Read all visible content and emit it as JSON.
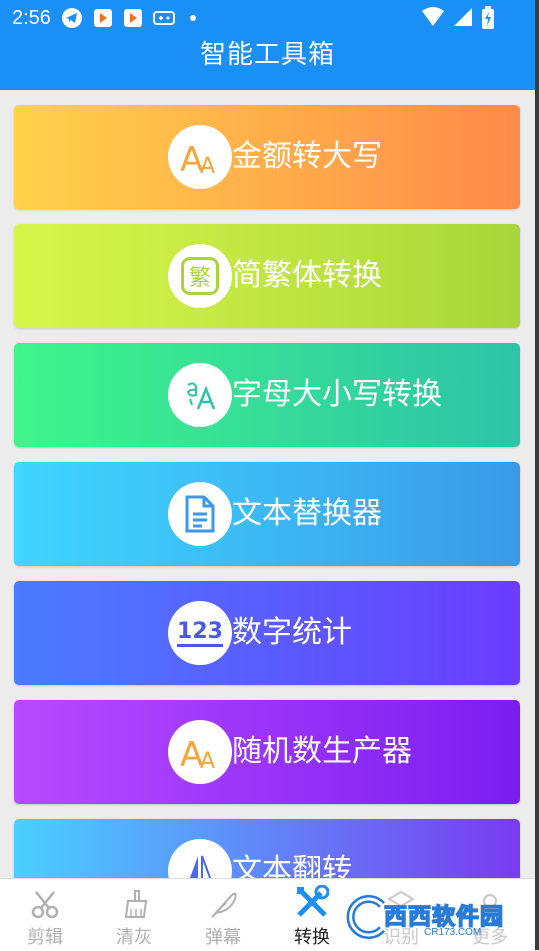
{
  "status": {
    "time": "2:56"
  },
  "header": {
    "title": "智能工具箱"
  },
  "tools": [
    {
      "label": "金额转大写",
      "icon": "text-size-icon"
    },
    {
      "label": "简繁体转换",
      "icon": "traditional-char-icon"
    },
    {
      "label": "字母大小写转换",
      "icon": "letter-case-icon"
    },
    {
      "label": "文本替换器",
      "icon": "document-icon"
    },
    {
      "label": "数字统计",
      "icon": "numbers-123-icon"
    },
    {
      "label": "随机数生产器",
      "icon": "text-size-icon"
    },
    {
      "label": "文本翻转",
      "icon": "flip-icon"
    }
  ],
  "traditional_glyph": "繁",
  "numbers_glyph": "123",
  "tabs": [
    {
      "label": "剪辑",
      "icon": "scissors-icon",
      "active": false
    },
    {
      "label": "清灰",
      "icon": "brush-icon",
      "active": false
    },
    {
      "label": "弹幕",
      "icon": "feather-icon",
      "active": false
    },
    {
      "label": "转换",
      "icon": "tools-icon",
      "active": true
    },
    {
      "label": "识别",
      "icon": "scan-icon",
      "active": false
    },
    {
      "label": "更多",
      "icon": "more-icon",
      "active": false
    }
  ],
  "watermark": {
    "text": "西西软件园",
    "sub": "CR173.COM"
  },
  "colors": {
    "appbar": "#1a8ff5",
    "active_tab": "#1a8ff5",
    "inactive_tab": "#b0b0b0"
  }
}
